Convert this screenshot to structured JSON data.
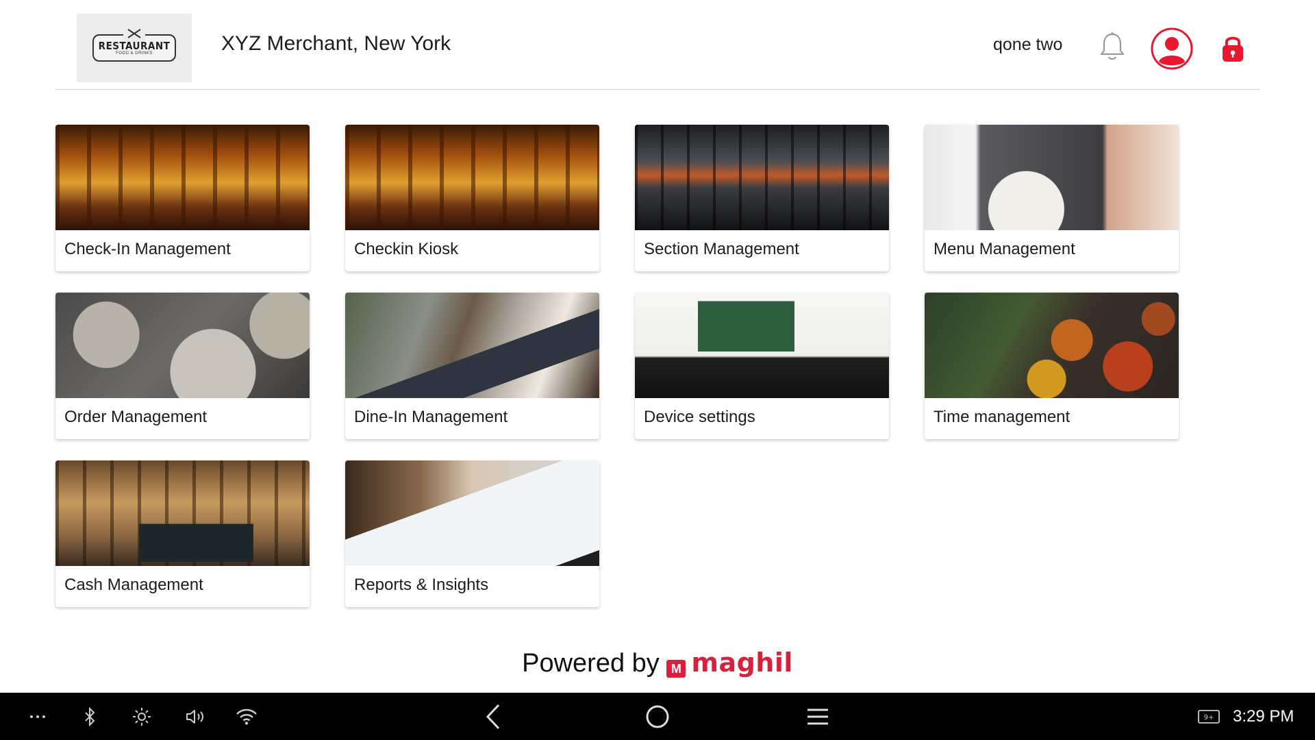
{
  "header": {
    "logo": {
      "main": "RESTAURANT",
      "sub": "FOOD & DRINKS"
    },
    "merchant_title": "XYZ Merchant, New York",
    "user_name": "qone two",
    "icons": {
      "notifications": "bell-icon",
      "profile": "user-circle-icon",
      "lock": "lock-icon"
    },
    "accent_color": "#e8192f"
  },
  "tiles": [
    {
      "label": "Check-In Management",
      "image": "restaurant-interior"
    },
    {
      "label": "Checkin Kiosk",
      "image": "restaurant-interior"
    },
    {
      "label": "Section Management",
      "image": "dining-section"
    },
    {
      "label": "Menu Management",
      "image": "menu-and-dish"
    },
    {
      "label": "Order Management",
      "image": "plated-food"
    },
    {
      "label": "Dine-In Management",
      "image": "tablet-at-table"
    },
    {
      "label": "Device settings",
      "image": "computer-setup"
    },
    {
      "label": "Time management",
      "image": "spread-of-dishes"
    },
    {
      "label": "Cash Management",
      "image": "pos-register"
    },
    {
      "label": "Reports & Insights",
      "image": "analytics-tablet"
    }
  ],
  "footer": {
    "powered_by": "Powered by",
    "brand": "maghil",
    "brand_color": "#d9203d"
  },
  "system_bar": {
    "left_icons": [
      "more-icon",
      "bluetooth-icon",
      "brightness-icon",
      "volume-icon",
      "wifi-icon"
    ],
    "center_icons": [
      "back-icon",
      "home-icon",
      "recents-icon"
    ],
    "right_icon": "keyboard-icon",
    "time": "3:29 PM"
  }
}
